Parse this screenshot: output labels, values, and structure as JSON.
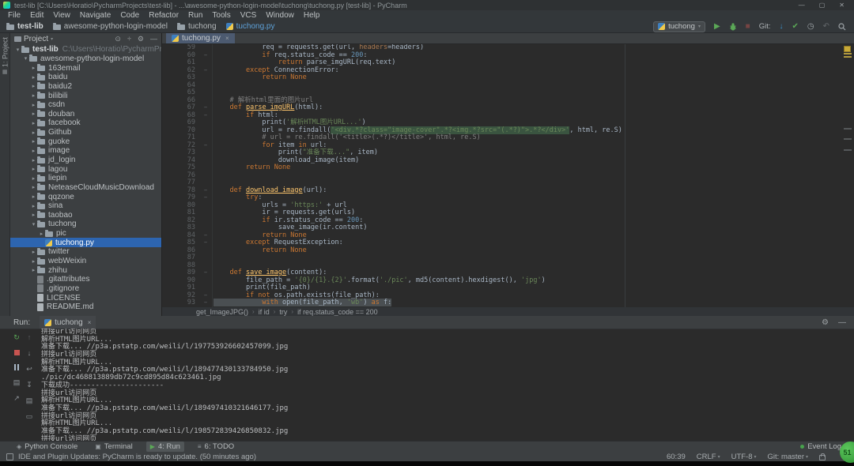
{
  "window": {
    "title": "test-lib [C:\\Users\\Horatio\\PycharmProjects\\test-lib] - ...\\awesome-python-login-model\\tuchong\\tuchong.py [test-lib] - PyCharm"
  },
  "menu": [
    "File",
    "Edit",
    "View",
    "Navigate",
    "Code",
    "Refactor",
    "Run",
    "Tools",
    "VCS",
    "Window",
    "Help"
  ],
  "breadcrumbs": [
    "test-lib",
    "awesome-python-login-model",
    "tuchong",
    "tuchong.py"
  ],
  "toolbar": {
    "run_config": "tuchong",
    "git_label": "Git:"
  },
  "activity": {
    "top": "1: Project",
    "favorites": "2: Favorites",
    "structure": "7: Structure"
  },
  "project": {
    "header": "Project",
    "header_icons": [
      "locate",
      "collapse-all",
      "gear",
      "minimize-panel"
    ],
    "tree": [
      {
        "label": "test-lib",
        "path": "C:\\Users\\Horatio\\PycharmProjects\\test-lib",
        "depth": 0,
        "icon": "folder",
        "arrow": "down",
        "bold": true
      },
      {
        "label": "awesome-python-login-model",
        "depth": 1,
        "icon": "folder",
        "arrow": "down"
      },
      {
        "label": "163email",
        "depth": 2,
        "icon": "folder",
        "arrow": "right"
      },
      {
        "label": "baidu",
        "depth": 2,
        "icon": "folder",
        "arrow": "right"
      },
      {
        "label": "baidu2",
        "depth": 2,
        "icon": "folder",
        "arrow": "right"
      },
      {
        "label": "bilibili",
        "depth": 2,
        "icon": "folder",
        "arrow": "right"
      },
      {
        "label": "csdn",
        "depth": 2,
        "icon": "folder",
        "arrow": "right"
      },
      {
        "label": "douban",
        "depth": 2,
        "icon": "folder",
        "arrow": "right"
      },
      {
        "label": "facebook",
        "depth": 2,
        "icon": "folder",
        "arrow": "right"
      },
      {
        "label": "Github",
        "depth": 2,
        "icon": "folder",
        "arrow": "right"
      },
      {
        "label": "guoke",
        "depth": 2,
        "icon": "folder",
        "arrow": "right"
      },
      {
        "label": "image",
        "depth": 2,
        "icon": "folder",
        "arrow": "right"
      },
      {
        "label": "jd_login",
        "depth": 2,
        "icon": "folder",
        "arrow": "right"
      },
      {
        "label": "lagou",
        "depth": 2,
        "icon": "folder",
        "arrow": "right"
      },
      {
        "label": "liepin",
        "depth": 2,
        "icon": "folder",
        "arrow": "right"
      },
      {
        "label": "NeteaseCloudMusicDownload",
        "depth": 2,
        "icon": "folder",
        "arrow": "right"
      },
      {
        "label": "qqzone",
        "depth": 2,
        "icon": "folder",
        "arrow": "right"
      },
      {
        "label": "sina",
        "depth": 2,
        "icon": "folder",
        "arrow": "right"
      },
      {
        "label": "taobao",
        "depth": 2,
        "icon": "folder",
        "arrow": "right"
      },
      {
        "label": "tuchong",
        "depth": 2,
        "icon": "folder",
        "arrow": "down"
      },
      {
        "label": "pic",
        "depth": 3,
        "icon": "folder",
        "arrow": "right"
      },
      {
        "label": "tuchong.py",
        "depth": 3,
        "icon": "python",
        "selected": true
      },
      {
        "label": "twitter",
        "depth": 2,
        "icon": "folder",
        "arrow": "right"
      },
      {
        "label": "webWeixin",
        "depth": 2,
        "icon": "folder",
        "arrow": "right"
      },
      {
        "label": "zhihu",
        "depth": 2,
        "icon": "folder",
        "arrow": "right"
      },
      {
        "label": ".gitattributes",
        "depth": 2,
        "icon": "file-dim"
      },
      {
        "label": ".gitignore",
        "depth": 2,
        "icon": "file-dim"
      },
      {
        "label": "LICENSE",
        "depth": 2,
        "icon": "file"
      },
      {
        "label": "README.md",
        "depth": 2,
        "icon": "file"
      }
    ]
  },
  "editor": {
    "tab": "tuchong.py",
    "breadcrumb": [
      "get_ImageJPG()",
      "if id",
      "try",
      "if req.status_code == 200"
    ],
    "lines": [
      {
        "n": 59,
        "s": [
          [
            "            req = requests.get(url, ",
            "d"
          ],
          [
            "headers",
            "a"
          ],
          [
            "=headers)",
            "d"
          ]
        ]
      },
      {
        "n": 60,
        "f": 1,
        "s": [
          [
            "            ",
            "d"
          ],
          [
            "if",
            "k"
          ],
          [
            " req.status_code == ",
            "d"
          ],
          [
            "200",
            "n"
          ],
          [
            ":",
            "d"
          ]
        ]
      },
      {
        "n": 61,
        "s": [
          [
            "                ",
            "d"
          ],
          [
            "return",
            "k"
          ],
          [
            " parse_imgURL(req.text)",
            "d"
          ]
        ]
      },
      {
        "n": 62,
        "f": 1,
        "s": [
          [
            "        ",
            "d"
          ],
          [
            "except",
            "k"
          ],
          [
            " ConnectionError:",
            "d"
          ]
        ]
      },
      {
        "n": 63,
        "s": [
          [
            "            ",
            "d"
          ],
          [
            "return None",
            "k"
          ]
        ]
      },
      {
        "n": 64,
        "s": []
      },
      {
        "n": 65,
        "s": []
      },
      {
        "n": 66,
        "s": [
          [
            "    # 解析html里面的图片url",
            "c"
          ]
        ]
      },
      {
        "n": 67,
        "f": 1,
        "s": [
          [
            "    ",
            "d"
          ],
          [
            "def ",
            "k"
          ],
          [
            "parse_imgURL",
            "f"
          ],
          [
            "(html):",
            "d"
          ]
        ]
      },
      {
        "n": 68,
        "f": 1,
        "s": [
          [
            "        ",
            "d"
          ],
          [
            "if",
            "k"
          ],
          [
            " html:",
            "d"
          ]
        ]
      },
      {
        "n": 69,
        "s": [
          [
            "            print(",
            "d"
          ],
          [
            "'解析HTML图片URL...'",
            "s"
          ],
          [
            ")",
            "d"
          ]
        ]
      },
      {
        "n": 70,
        "s": [
          [
            "            url = re.findall(",
            "d"
          ],
          [
            "'<div.*?class=\"image-cover\".*?<img.*?src=\"(.*?)\">.*?</div>'",
            "sh"
          ],
          [
            ", html, re.S)",
            "d"
          ]
        ]
      },
      {
        "n": 71,
        "s": [
          [
            "            # url = re.findall('<title>(.*?)</title>', html, re.S)",
            "c"
          ]
        ]
      },
      {
        "n": 72,
        "f": 1,
        "s": [
          [
            "            ",
            "d"
          ],
          [
            "for",
            "k"
          ],
          [
            " item ",
            "d"
          ],
          [
            "in",
            "k"
          ],
          [
            " url:",
            "d"
          ]
        ]
      },
      {
        "n": 73,
        "s": [
          [
            "                print(",
            "d"
          ],
          [
            "\"准备下载...\"",
            "s"
          ],
          [
            ", item)",
            "d"
          ]
        ]
      },
      {
        "n": 74,
        "s": [
          [
            "                download_image(item)",
            "d"
          ]
        ]
      },
      {
        "n": 75,
        "s": [
          [
            "        ",
            "d"
          ],
          [
            "return None",
            "k"
          ]
        ]
      },
      {
        "n": 76,
        "s": []
      },
      {
        "n": 77,
        "s": []
      },
      {
        "n": 78,
        "f": 1,
        "s": [
          [
            "    ",
            "d"
          ],
          [
            "def ",
            "k"
          ],
          [
            "download_image",
            "f"
          ],
          [
            "(url):",
            "d"
          ]
        ]
      },
      {
        "n": 79,
        "f": 1,
        "s": [
          [
            "        ",
            "d"
          ],
          [
            "try",
            "k"
          ],
          [
            ":",
            "d"
          ]
        ]
      },
      {
        "n": 80,
        "s": [
          [
            "            urls = ",
            "d"
          ],
          [
            "'https:'",
            "s"
          ],
          [
            " + url",
            "d"
          ]
        ]
      },
      {
        "n": 81,
        "s": [
          [
            "            ir = requests.get(urls)",
            "d"
          ]
        ]
      },
      {
        "n": 82,
        "s": [
          [
            "            ",
            "d"
          ],
          [
            "if",
            "k"
          ],
          [
            " ir.status_code == ",
            "d"
          ],
          [
            "200",
            "n"
          ],
          [
            ":",
            "d"
          ]
        ]
      },
      {
        "n": 83,
        "s": [
          [
            "                save_image(ir.content)",
            "d"
          ]
        ]
      },
      {
        "n": 84,
        "f": 1,
        "s": [
          [
            "            ",
            "d"
          ],
          [
            "return None",
            "k"
          ]
        ]
      },
      {
        "n": 85,
        "f": 1,
        "s": [
          [
            "        ",
            "d"
          ],
          [
            "except",
            "k"
          ],
          [
            " RequestException:",
            "d"
          ]
        ]
      },
      {
        "n": 86,
        "s": [
          [
            "            ",
            "d"
          ],
          [
            "return None",
            "k"
          ]
        ]
      },
      {
        "n": 87,
        "s": []
      },
      {
        "n": 88,
        "s": []
      },
      {
        "n": 89,
        "f": 1,
        "s": [
          [
            "    ",
            "d"
          ],
          [
            "def ",
            "k"
          ],
          [
            "save_image",
            "f"
          ],
          [
            "(content):",
            "d"
          ]
        ]
      },
      {
        "n": 90,
        "s": [
          [
            "        file_path = ",
            "d"
          ],
          [
            "'{0}/{1}.{2}'",
            "s"
          ],
          [
            ".format(",
            "d"
          ],
          [
            "'./pic'",
            "s"
          ],
          [
            ", md5(content).hexdigest(), ",
            "d"
          ],
          [
            "'jpg'",
            "s"
          ],
          [
            ")",
            "d"
          ]
        ]
      },
      {
        "n": 91,
        "s": [
          [
            "        print(file_path)",
            "d"
          ]
        ]
      },
      {
        "n": 92,
        "f": 1,
        "s": [
          [
            "        ",
            "d"
          ],
          [
            "if not",
            "k"
          ],
          [
            " os.path.exists(file_path):",
            "d"
          ]
        ]
      },
      {
        "n": 93,
        "f": 1,
        "sel": 1,
        "s": [
          [
            "            ",
            "d"
          ],
          [
            "with",
            "k"
          ],
          [
            " open(file_path, ",
            "d"
          ],
          [
            "'wb'",
            "s"
          ],
          [
            ") ",
            "d"
          ],
          [
            "as",
            "k"
          ],
          [
            " f:",
            "d"
          ]
        ]
      }
    ]
  },
  "run": {
    "label": "Run:",
    "tab": "tuchong",
    "toolbar_col1": [
      "rerun",
      "stop",
      "pause",
      "layout",
      "pin"
    ],
    "toolbar_col2": [
      "up",
      "down",
      "softwrap",
      "scrollend",
      "print",
      "clear"
    ],
    "header_icons": [
      "gear",
      "minimize-panel"
    ],
    "console": [
      "拼接url访问网页",
      "解析HTML图片URL...",
      "准备下载... //p3a.pstatp.com/weili/l/197753926602457099.jpg",
      "拼接url访问网页",
      "解析HTML图片URL...",
      "准备下载... //p3a.pstatp.com/weili/l/189477430133784950.jpg",
      "./pic/dc468813889db72c9cd895d84c623461.jpg",
      "下载成功----------------------",
      "拼接url访问网页",
      "解析HTML图片URL...",
      "准备下载... //p3a.pstatp.com/weili/l/189497410321646177.jpg",
      "拼接url访问网页",
      "解析HTML图片URL...",
      "准备下载... //p3a.pstatp.com/weili/l/198572839426850832.jpg",
      "拼接url访问网页"
    ]
  },
  "toolwindows": [
    {
      "label": "Python Console",
      "icon": "pyconsole",
      "active": false
    },
    {
      "label": "Terminal",
      "icon": "terminal",
      "active": false
    },
    {
      "label": "4: Run",
      "icon": "play-sm",
      "active": true
    },
    {
      "label": "6: TODO",
      "icon": "todo",
      "active": false
    }
  ],
  "statusbar": {
    "message": "IDE and Plugin Updates: PyCharm is ready to update. (50 minutes ago)",
    "event_log": "Event Log",
    "right": [
      {
        "label": "60:39",
        "chevron": false
      },
      {
        "label": "CRLF",
        "chevron": true
      },
      {
        "label": "UTF-8",
        "chevron": true
      },
      {
        "label": "Git: master",
        "chevron": true
      }
    ]
  },
  "overlay": {
    "badge": "51"
  },
  "icons": {
    "win-min": "—",
    "win-max": "▢",
    "win-close": "✕",
    "play": "▶",
    "stop": "■",
    "update": "↓",
    "commit-check": "✔",
    "history": "◷",
    "undo": "↶",
    "gear": "⚙",
    "minimize-panel": "—",
    "locate": "⊙",
    "collapse-all": "÷",
    "chevron-down": "▾",
    "arrow-right": "▸",
    "arrow-down": "▾",
    "close": "×",
    "rerun": "↻",
    "pause": "‖",
    "layout": "▤",
    "pin": "↗",
    "up": "↑",
    "down": "↓",
    "softwrap": "↩",
    "scrollend": "↧",
    "print": "▤",
    "clear": "▭",
    "pyconsole": "◈",
    "terminal": "▣",
    "play-sm": "▶",
    "todo": "≡",
    "star": "★",
    "structure": "≡",
    "project": "▦"
  },
  "colors": {
    "accent_blue": "#2d65b0",
    "run_green": "#5ba857",
    "stop_red": "#c75450",
    "stripe_yellow": "#c8a937"
  }
}
